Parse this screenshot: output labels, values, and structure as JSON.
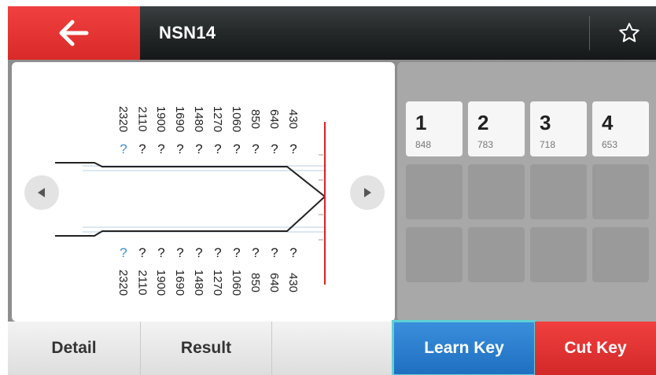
{
  "header": {
    "title": "NSN14",
    "back_icon": "arrow-left-icon",
    "favorite_icon": "star-outline-icon"
  },
  "key_view": {
    "depths": [
      "2320",
      "2110",
      "1900",
      "1690",
      "1480",
      "1270",
      "1060",
      "850",
      "640",
      "430"
    ],
    "top_marks": [
      "?",
      "?",
      "?",
      "?",
      "?",
      "?",
      "?",
      "?",
      "?",
      "?"
    ],
    "bottom_marks": [
      "?",
      "?",
      "?",
      "?",
      "?",
      "?",
      "?",
      "?",
      "?",
      "?"
    ],
    "active_index": 0,
    "active_color": "#3b8fd8",
    "tip_line_color": "#e02020"
  },
  "cuts": [
    {
      "position": "1",
      "value": "848"
    },
    {
      "position": "2",
      "value": "783"
    },
    {
      "position": "3",
      "value": "718"
    },
    {
      "position": "4",
      "value": "653"
    }
  ],
  "toolbar": {
    "detail_label": "Detail",
    "result_label": "Result",
    "learn_key_label": "Learn Key",
    "cut_key_label": "Cut Key"
  },
  "colors": {
    "accent_red": "#e53935",
    "accent_blue": "#2a7fd0",
    "highlight_outline": "#5fd0d6"
  }
}
